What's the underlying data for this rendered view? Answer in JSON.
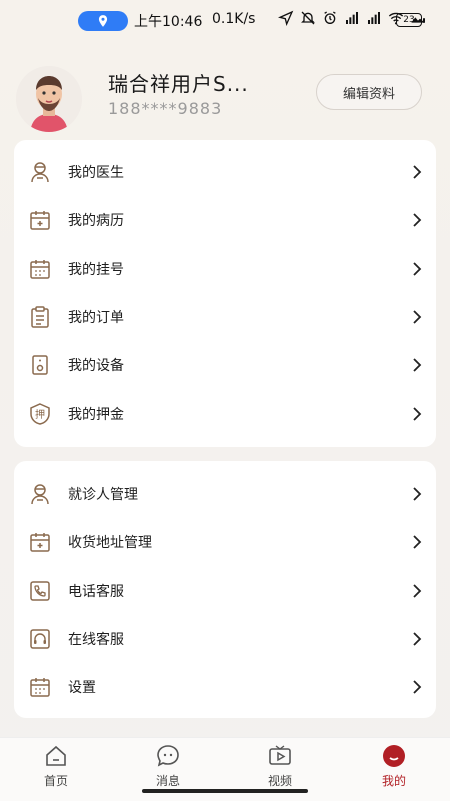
{
  "status_bar": {
    "time": "上午10:46",
    "speed": "0.1K/s",
    "battery": "23"
  },
  "profile": {
    "name": "瑞合祥用户S...",
    "phone": "188****9883",
    "edit_label": "编辑资料"
  },
  "menu_primary": [
    {
      "label": "我的医生",
      "icon": "doctor-icon"
    },
    {
      "label": "我的病历",
      "icon": "medical-record-icon"
    },
    {
      "label": "我的挂号",
      "icon": "calendar-icon"
    },
    {
      "label": "我的订单",
      "icon": "clipboard-icon"
    },
    {
      "label": "我的设备",
      "icon": "device-icon"
    },
    {
      "label": "我的押金",
      "icon": "deposit-icon"
    }
  ],
  "menu_secondary": [
    {
      "label": "就诊人管理",
      "icon": "patient-icon"
    },
    {
      "label": "收货地址管理",
      "icon": "address-icon"
    },
    {
      "label": "电话客服",
      "icon": "phone-icon"
    },
    {
      "label": "在线客服",
      "icon": "headset-icon"
    },
    {
      "label": "设置",
      "icon": "settings-calendar-icon"
    }
  ],
  "deposit_glyph": "押",
  "tabs": [
    {
      "label": "首页",
      "icon": "home-icon"
    },
    {
      "label": "消息",
      "icon": "message-icon"
    },
    {
      "label": "视频",
      "icon": "video-icon"
    },
    {
      "label": "我的",
      "icon": "profile-icon",
      "active": true
    }
  ],
  "colors": {
    "accent": "#b11f25",
    "icon_stroke": "#8a6a4e",
    "location_pill": "#2f7cf6"
  }
}
